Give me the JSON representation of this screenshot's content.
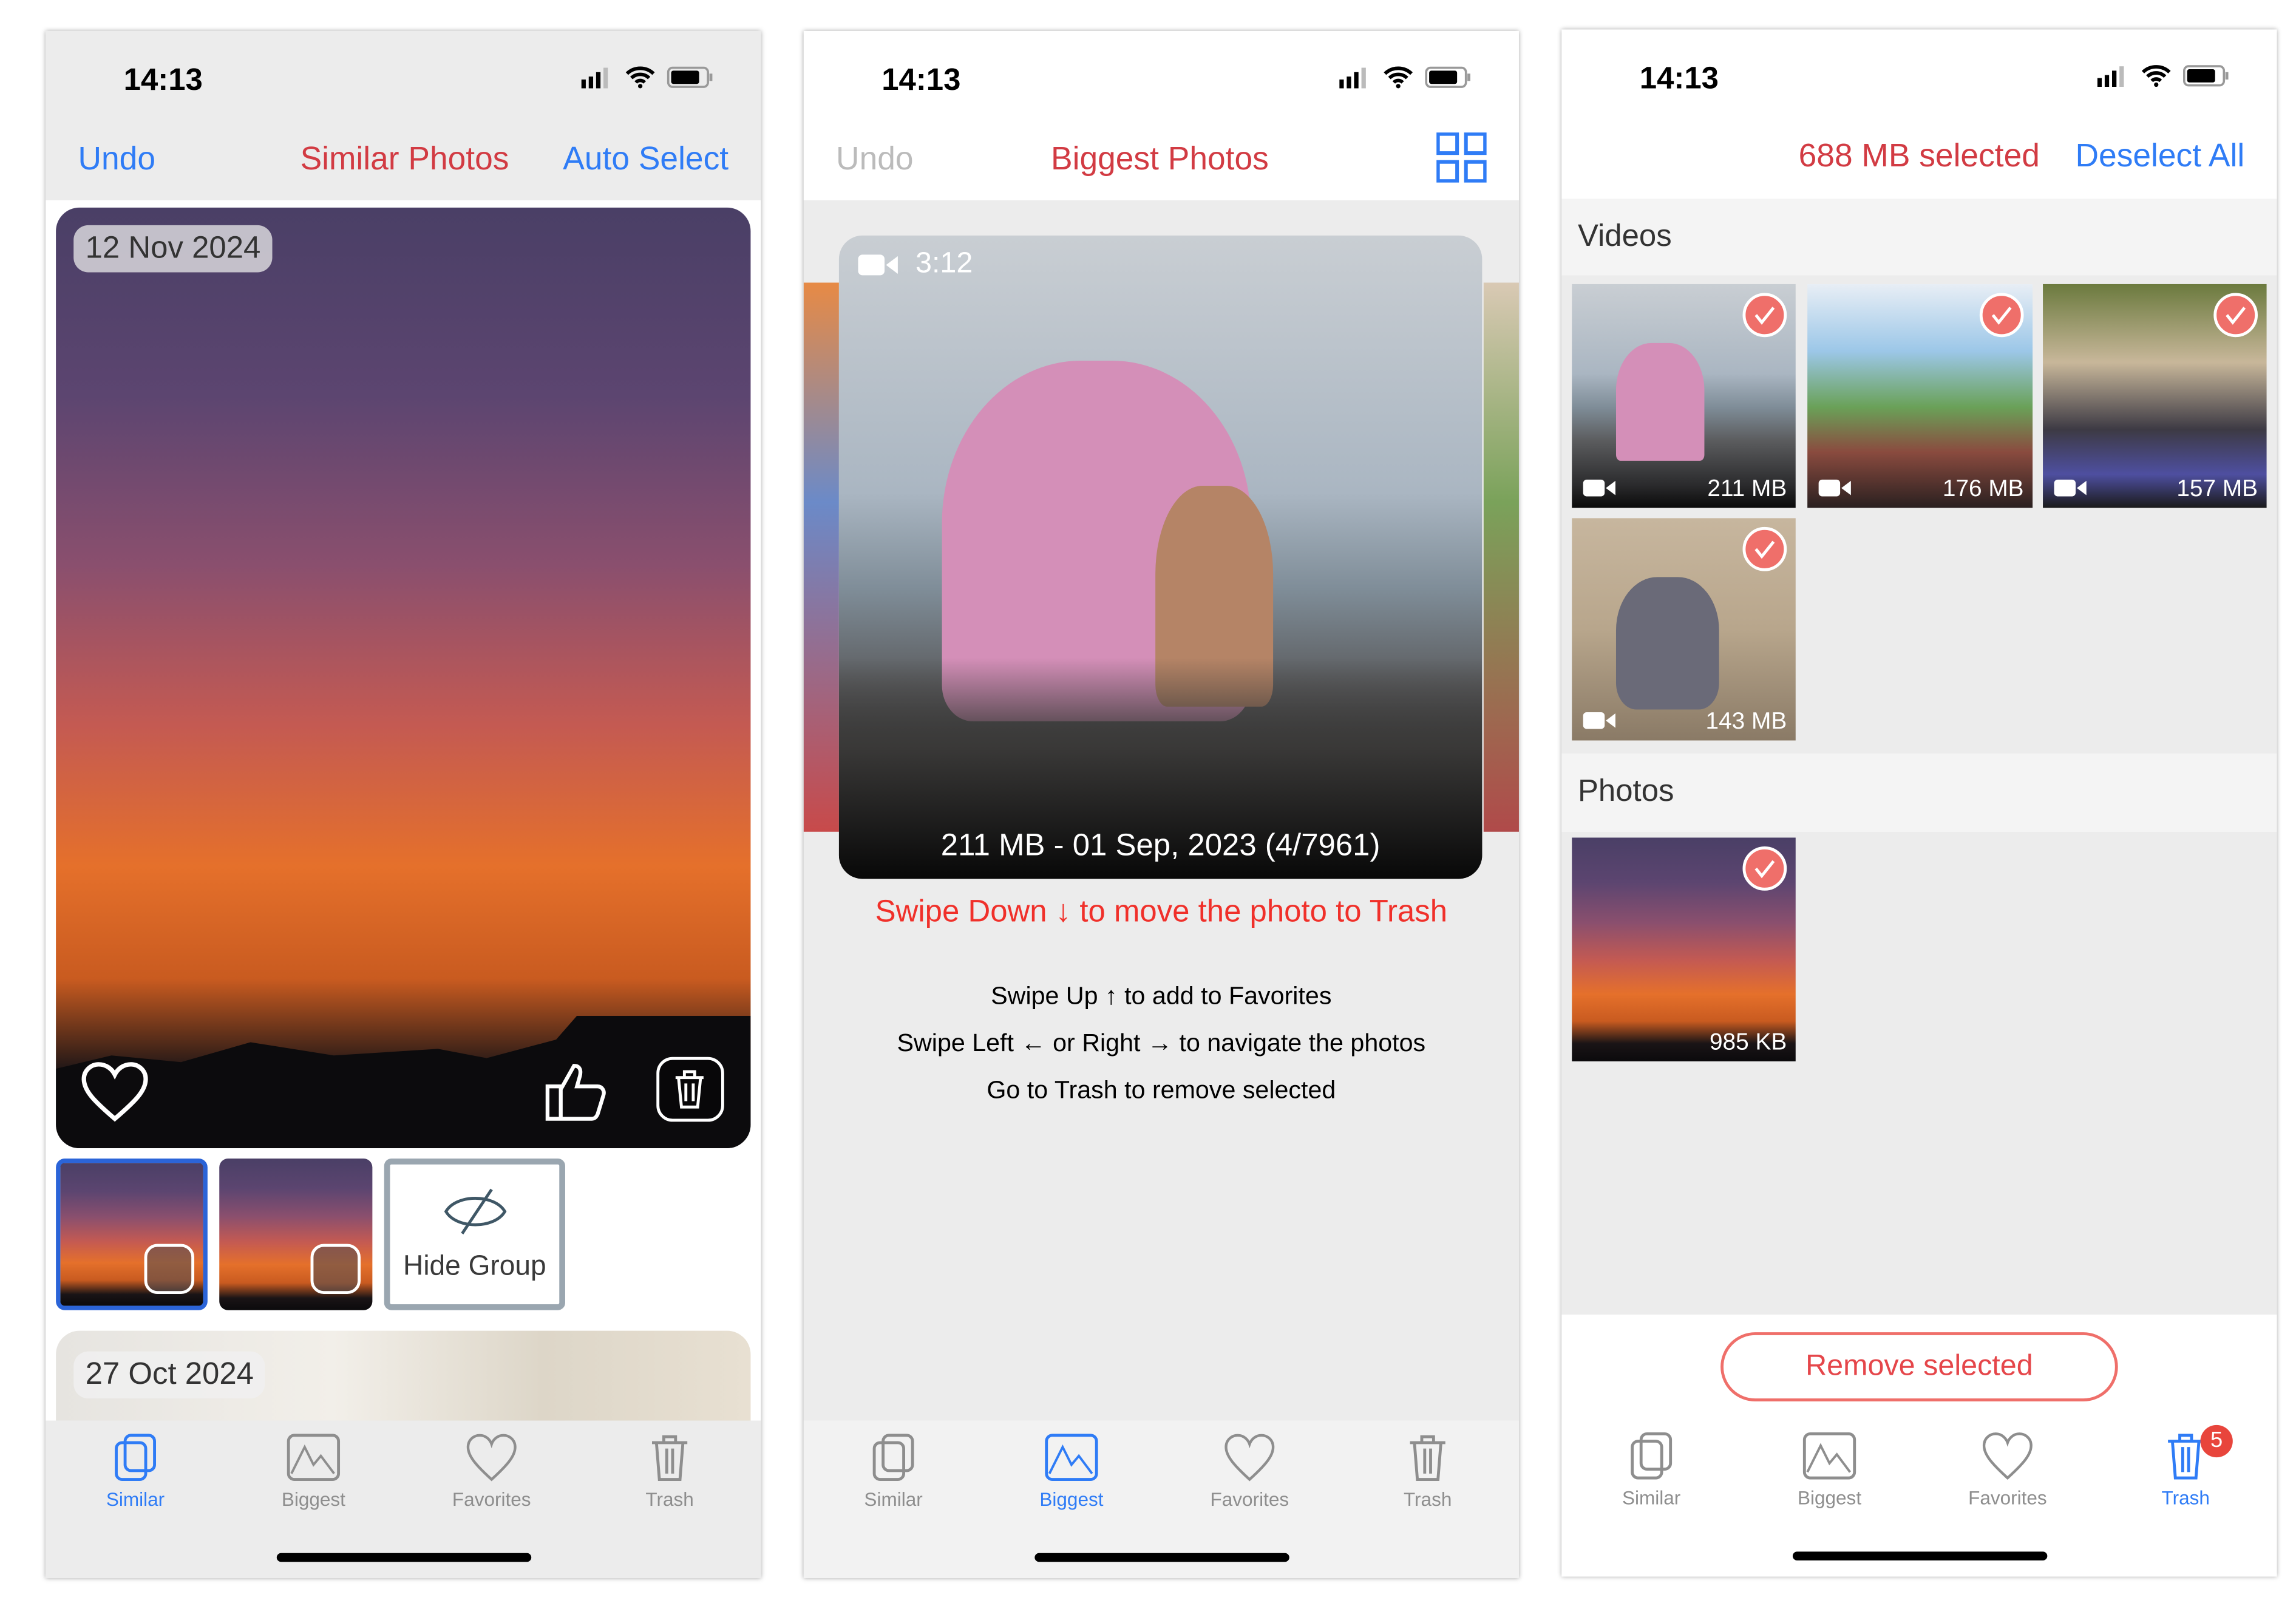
{
  "status": {
    "time": "14:13"
  },
  "colors": {
    "accent_blue": "#2f7cf6",
    "title_red": "#d23b43",
    "selection_red": "#ef6f6a",
    "badge_red": "#e8453c"
  },
  "tabs": [
    {
      "label": "Similar",
      "icon": "similar-icon"
    },
    {
      "label": "Biggest",
      "icon": "biggest-icon"
    },
    {
      "label": "Favorites",
      "icon": "heart-icon"
    },
    {
      "label": "Trash",
      "icon": "trash-icon"
    }
  ],
  "similar": {
    "undo": "Undo",
    "title": "Similar Photos",
    "auto_select": "Auto Select",
    "group1_date": "12 Nov 2024",
    "hide_group": "Hide Group",
    "group2_date": "27 Oct 2024",
    "active_tab": "Similar"
  },
  "biggest": {
    "undo": "Undo",
    "title": "Biggest Photos",
    "duration": "3:12",
    "caption": "211 MB - 01 Sep, 2023 (4/7961)",
    "swipe_down": "Swipe Down ↓ to move the photo to Trash",
    "instructions": [
      "Swipe Up ↑ to add to Favorites",
      "Swipe Left ← or Right → to navigate the photos",
      "Go to Trash to remove selected"
    ],
    "active_tab": "Biggest"
  },
  "trash": {
    "selected": "688 MB selected",
    "deselect_all": "Deselect All",
    "videos_header": "Videos",
    "videos": [
      {
        "size": "211 MB"
      },
      {
        "size": "176 MB"
      },
      {
        "size": "157 MB"
      },
      {
        "size": "143 MB"
      }
    ],
    "photos_header": "Photos",
    "photos": [
      {
        "size": "985 KB"
      }
    ],
    "remove_selected": "Remove selected",
    "badge": "5",
    "active_tab": "Trash"
  }
}
